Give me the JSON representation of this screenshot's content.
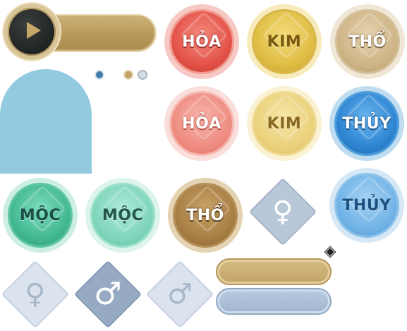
{
  "player": {
    "play_icon": "play-icon",
    "colors": {
      "bar": "#c2a266",
      "disc": "#232626"
    }
  },
  "pager": {
    "colors": {
      "active": "#3f7cac",
      "gold": "#c2a266",
      "inactive": "#d5dde5"
    }
  },
  "elements": {
    "fire": "HỎA",
    "metal": "KIM",
    "earth": "THỔ",
    "water": "THỦY",
    "wood": "MỘC"
  },
  "gender": {
    "female_symbol": "♀",
    "male_symbol": "♂"
  },
  "colors": {
    "panel_blue": "#92cbdf",
    "fire": "#e4544a",
    "metal": "#e0be45",
    "earth": "#a97f45",
    "water": "#2f86d3",
    "wood": "#43b992"
  }
}
